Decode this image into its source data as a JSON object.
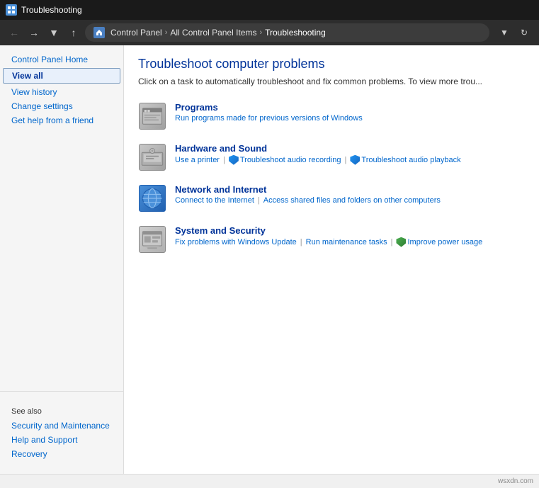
{
  "titlebar": {
    "icon": "troubleshooting-icon",
    "title": "Troubleshooting"
  },
  "addressbar": {
    "path_icon": "control-panel-icon",
    "path_parts": [
      "Control Panel",
      "All Control Panel Items",
      "Troubleshooting"
    ]
  },
  "sidebar": {
    "top_link": "Control Panel Home",
    "active_link": "View all",
    "links": [
      "View history",
      "Change settings",
      "Get help from a friend"
    ],
    "see_also_label": "See also",
    "see_also_links": [
      "Security and Maintenance",
      "Help and Support",
      "Recovery"
    ]
  },
  "content": {
    "title": "Troubleshoot computer problems",
    "description": "Click on a task to automatically troubleshoot and fix common problems. To view more trou...",
    "items": [
      {
        "id": "programs",
        "title": "Programs",
        "subtitle": "Run programs made for previous versions of Windows",
        "links": []
      },
      {
        "id": "hardware",
        "title": "Hardware and Sound",
        "subtitle": "",
        "links": [
          {
            "label": "Use a printer",
            "icon": null
          },
          {
            "label": "Troubleshoot audio recording",
            "icon": "shield-blue"
          },
          {
            "label": "Troubleshoot audio playback",
            "icon": "shield-blue"
          }
        ]
      },
      {
        "id": "network",
        "title": "Network and Internet",
        "subtitle": "",
        "links": [
          {
            "label": "Connect to the Internet",
            "icon": null
          },
          {
            "label": "Access shared files and folders on other computers",
            "icon": null
          }
        ]
      },
      {
        "id": "system",
        "title": "System and Security",
        "subtitle": "",
        "links": [
          {
            "label": "Fix problems with Windows Update",
            "icon": null
          },
          {
            "label": "Run maintenance tasks",
            "icon": null
          },
          {
            "label": "Improve power usage",
            "icon": "shield-green"
          }
        ]
      }
    ]
  },
  "bottombar": {
    "text": "wsxdn.com"
  }
}
